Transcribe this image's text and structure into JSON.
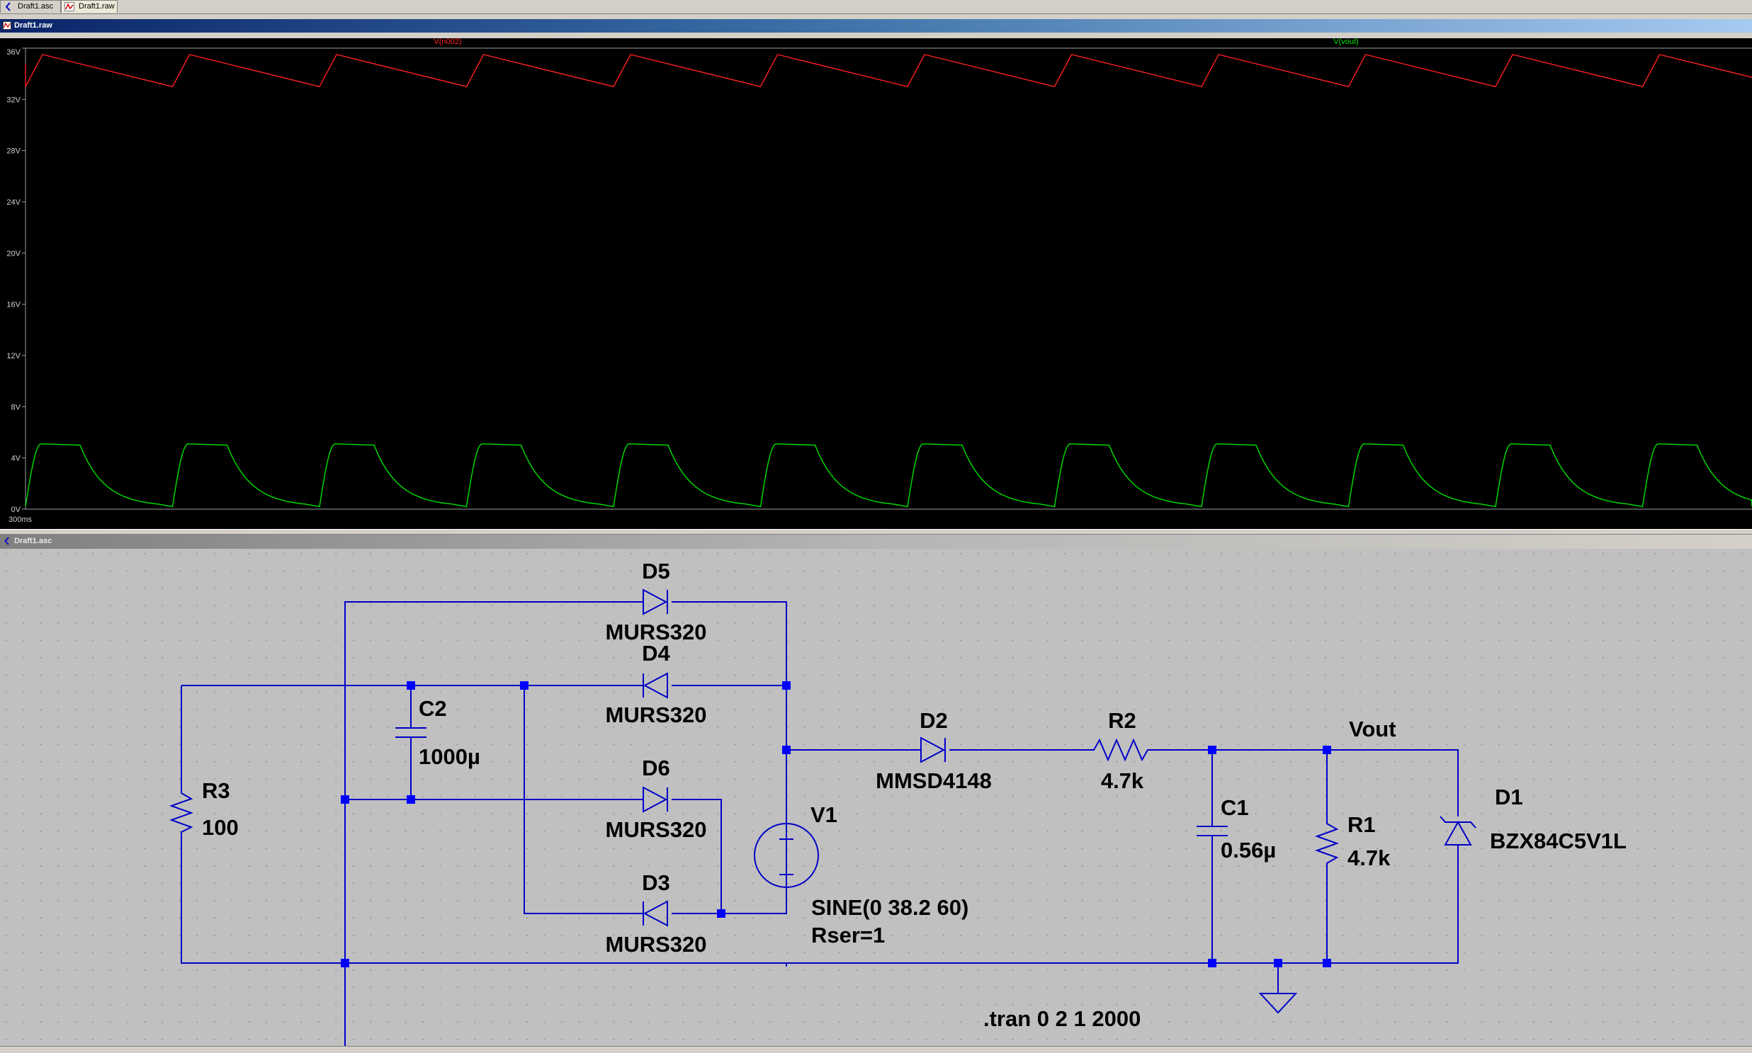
{
  "tabs": [
    {
      "label": "Draft1.asc",
      "icon": "schematic-icon"
    },
    {
      "label": "Draft1.raw",
      "icon": "waveform-icon"
    }
  ],
  "plot_window": {
    "title": "Draft1.raw"
  },
  "schematic_window": {
    "title": "Draft1.asc"
  },
  "colors": {
    "trace_vn002": "#ff2020",
    "trace_vout": "#00e000",
    "plot_background": "#000000",
    "axis_text": "#d0d0d0",
    "wire": "#0000c8",
    "junction": "#0000ff",
    "schematic_background": "#c0c0c0"
  },
  "chart_data": {
    "type": "line",
    "x_start_label": "300ms",
    "period_ms": 16.667,
    "cycles_visible": 12,
    "ylim": [
      0,
      36
    ],
    "yticks": [
      {
        "value": 0,
        "label": "0V"
      },
      {
        "value": 4,
        "label": "4V"
      },
      {
        "value": 8,
        "label": "8V"
      },
      {
        "value": 12,
        "label": "12V"
      },
      {
        "value": 16,
        "label": "16V"
      },
      {
        "value": 20,
        "label": "20V"
      },
      {
        "value": 24,
        "label": "24V"
      },
      {
        "value": 28,
        "label": "28V"
      },
      {
        "value": 32,
        "label": "32V"
      },
      {
        "value": 36,
        "label": "36V"
      }
    ],
    "grid": false,
    "series": [
      {
        "name": "V(n002)",
        "color": "#ff2020",
        "shape": "sawtooth",
        "min": 33.0,
        "max": 35.5
      },
      {
        "name": "V(vout)",
        "color": "#00e000",
        "shape": "pulse",
        "min": 0.2,
        "max": 5.1
      }
    ]
  },
  "schematic": {
    "components": {
      "D5": {
        "name": "D5",
        "value": "MURS320"
      },
      "D4": {
        "name": "D4",
        "value": "MURS320"
      },
      "D6": {
        "name": "D6",
        "value": "MURS320"
      },
      "D3": {
        "name": "D3",
        "value": "MURS320"
      },
      "D2": {
        "name": "D2",
        "value": "MMSD4148"
      },
      "D1": {
        "name": "D1",
        "value": "BZX84C5V1L"
      },
      "C2": {
        "name": "C2",
        "value": "1000µ"
      },
      "C1": {
        "name": "C1",
        "value": "0.56µ"
      },
      "R3": {
        "name": "R3",
        "value": "100"
      },
      "R2": {
        "name": "R2",
        "value": "4.7k"
      },
      "R1": {
        "name": "R1",
        "value": "4.7k"
      },
      "V1": {
        "name": "V1",
        "value": "SINE(0 38.2 60)",
        "extra": "Rser=1"
      }
    },
    "net_label": "Vout",
    "directive": ".tran 0 2 1 2000"
  }
}
